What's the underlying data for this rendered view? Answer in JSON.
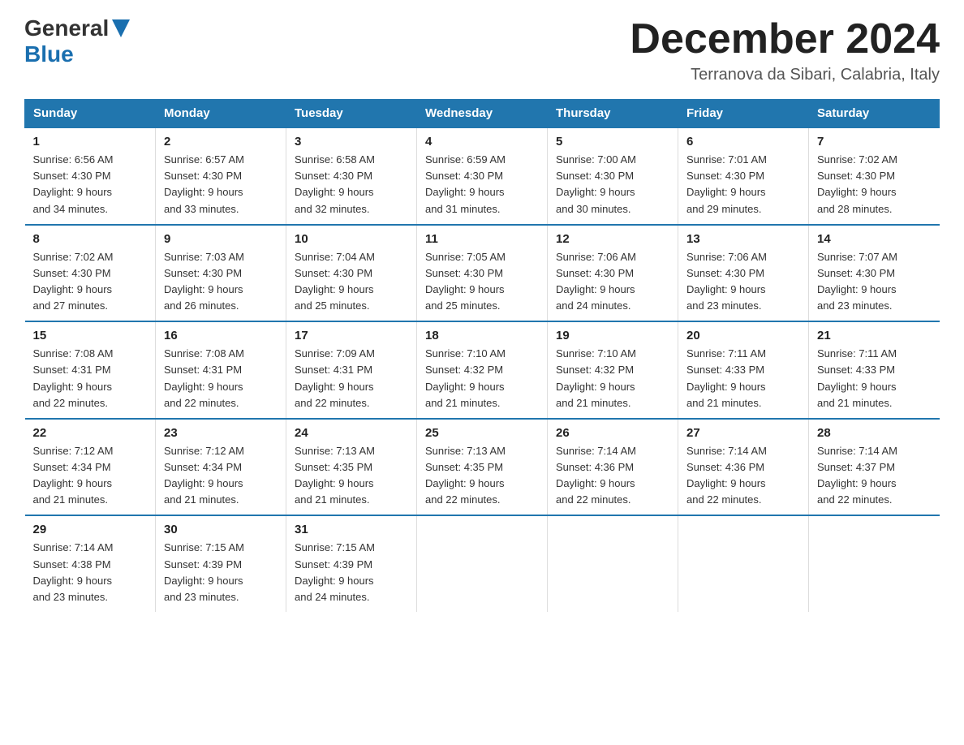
{
  "logo": {
    "general": "General",
    "blue": "Blue"
  },
  "header": {
    "month": "December 2024",
    "location": "Terranova da Sibari, Calabria, Italy"
  },
  "days_of_week": [
    "Sunday",
    "Monday",
    "Tuesday",
    "Wednesday",
    "Thursday",
    "Friday",
    "Saturday"
  ],
  "weeks": [
    [
      {
        "day": "1",
        "sunrise": "6:56 AM",
        "sunset": "4:30 PM",
        "daylight": "9 hours and 34 minutes."
      },
      {
        "day": "2",
        "sunrise": "6:57 AM",
        "sunset": "4:30 PM",
        "daylight": "9 hours and 33 minutes."
      },
      {
        "day": "3",
        "sunrise": "6:58 AM",
        "sunset": "4:30 PM",
        "daylight": "9 hours and 32 minutes."
      },
      {
        "day": "4",
        "sunrise": "6:59 AM",
        "sunset": "4:30 PM",
        "daylight": "9 hours and 31 minutes."
      },
      {
        "day": "5",
        "sunrise": "7:00 AM",
        "sunset": "4:30 PM",
        "daylight": "9 hours and 30 minutes."
      },
      {
        "day": "6",
        "sunrise": "7:01 AM",
        "sunset": "4:30 PM",
        "daylight": "9 hours and 29 minutes."
      },
      {
        "day": "7",
        "sunrise": "7:02 AM",
        "sunset": "4:30 PM",
        "daylight": "9 hours and 28 minutes."
      }
    ],
    [
      {
        "day": "8",
        "sunrise": "7:02 AM",
        "sunset": "4:30 PM",
        "daylight": "9 hours and 27 minutes."
      },
      {
        "day": "9",
        "sunrise": "7:03 AM",
        "sunset": "4:30 PM",
        "daylight": "9 hours and 26 minutes."
      },
      {
        "day": "10",
        "sunrise": "7:04 AM",
        "sunset": "4:30 PM",
        "daylight": "9 hours and 25 minutes."
      },
      {
        "day": "11",
        "sunrise": "7:05 AM",
        "sunset": "4:30 PM",
        "daylight": "9 hours and 25 minutes."
      },
      {
        "day": "12",
        "sunrise": "7:06 AM",
        "sunset": "4:30 PM",
        "daylight": "9 hours and 24 minutes."
      },
      {
        "day": "13",
        "sunrise": "7:06 AM",
        "sunset": "4:30 PM",
        "daylight": "9 hours and 23 minutes."
      },
      {
        "day": "14",
        "sunrise": "7:07 AM",
        "sunset": "4:30 PM",
        "daylight": "9 hours and 23 minutes."
      }
    ],
    [
      {
        "day": "15",
        "sunrise": "7:08 AM",
        "sunset": "4:31 PM",
        "daylight": "9 hours and 22 minutes."
      },
      {
        "day": "16",
        "sunrise": "7:08 AM",
        "sunset": "4:31 PM",
        "daylight": "9 hours and 22 minutes."
      },
      {
        "day": "17",
        "sunrise": "7:09 AM",
        "sunset": "4:31 PM",
        "daylight": "9 hours and 22 minutes."
      },
      {
        "day": "18",
        "sunrise": "7:10 AM",
        "sunset": "4:32 PM",
        "daylight": "9 hours and 21 minutes."
      },
      {
        "day": "19",
        "sunrise": "7:10 AM",
        "sunset": "4:32 PM",
        "daylight": "9 hours and 21 minutes."
      },
      {
        "day": "20",
        "sunrise": "7:11 AM",
        "sunset": "4:33 PM",
        "daylight": "9 hours and 21 minutes."
      },
      {
        "day": "21",
        "sunrise": "7:11 AM",
        "sunset": "4:33 PM",
        "daylight": "9 hours and 21 minutes."
      }
    ],
    [
      {
        "day": "22",
        "sunrise": "7:12 AM",
        "sunset": "4:34 PM",
        "daylight": "9 hours and 21 minutes."
      },
      {
        "day": "23",
        "sunrise": "7:12 AM",
        "sunset": "4:34 PM",
        "daylight": "9 hours and 21 minutes."
      },
      {
        "day": "24",
        "sunrise": "7:13 AM",
        "sunset": "4:35 PM",
        "daylight": "9 hours and 21 minutes."
      },
      {
        "day": "25",
        "sunrise": "7:13 AM",
        "sunset": "4:35 PM",
        "daylight": "9 hours and 22 minutes."
      },
      {
        "day": "26",
        "sunrise": "7:14 AM",
        "sunset": "4:36 PM",
        "daylight": "9 hours and 22 minutes."
      },
      {
        "day": "27",
        "sunrise": "7:14 AM",
        "sunset": "4:36 PM",
        "daylight": "9 hours and 22 minutes."
      },
      {
        "day": "28",
        "sunrise": "7:14 AM",
        "sunset": "4:37 PM",
        "daylight": "9 hours and 22 minutes."
      }
    ],
    [
      {
        "day": "29",
        "sunrise": "7:14 AM",
        "sunset": "4:38 PM",
        "daylight": "9 hours and 23 minutes."
      },
      {
        "day": "30",
        "sunrise": "7:15 AM",
        "sunset": "4:39 PM",
        "daylight": "9 hours and 23 minutes."
      },
      {
        "day": "31",
        "sunrise": "7:15 AM",
        "sunset": "4:39 PM",
        "daylight": "9 hours and 24 minutes."
      },
      null,
      null,
      null,
      null
    ]
  ],
  "labels": {
    "sunrise": "Sunrise:",
    "sunset": "Sunset:",
    "daylight": "Daylight:"
  }
}
